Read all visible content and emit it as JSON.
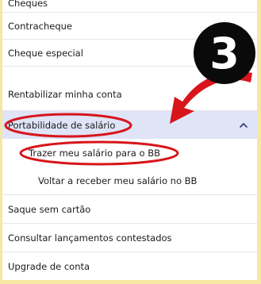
{
  "menu": {
    "items": [
      {
        "label": "Cheques"
      },
      {
        "label": "Contracheque"
      },
      {
        "label": "Cheque especial"
      },
      {
        "label": "Rentabilizar minha conta"
      },
      {
        "label": "Portabilidade de salário"
      },
      {
        "label": "Trazer meu salário para o BB"
      },
      {
        "label": "Voltar a receber meu salário no BB"
      },
      {
        "label": "Saque sem cartão"
      },
      {
        "label": "Consultar lançamentos contestados"
      },
      {
        "label": "Upgrade de conta"
      }
    ]
  },
  "annotation": {
    "step_number": "3",
    "highlight_color": "#d7151b",
    "badge_color": "#0a0a0a"
  },
  "colors": {
    "background": "#f6e7a2",
    "active_row": "#dfe4f7",
    "chevron": "#2c3a77"
  }
}
